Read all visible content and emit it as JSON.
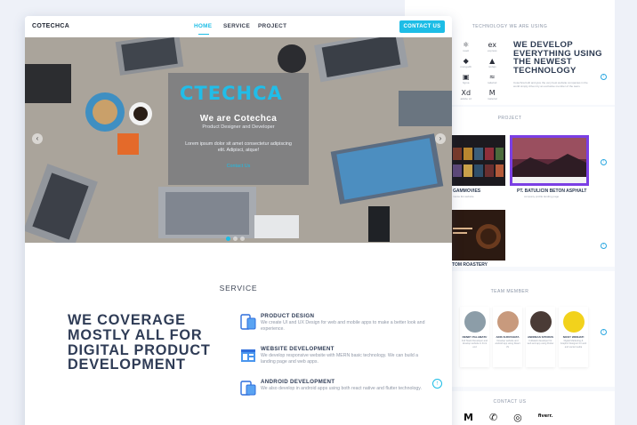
{
  "back": {
    "tech_title": "TECHNOLOGY WE ARE USING",
    "tech_icons": [
      {
        "glyph": "⚛",
        "label": "react",
        "icon": "react-icon"
      },
      {
        "glyph": "ex",
        "label": "express",
        "icon": "express-icon"
      },
      {
        "glyph": "◆",
        "label": "mongodb",
        "icon": "mongodb-icon"
      },
      {
        "glyph": "▲",
        "label": "nodejs",
        "icon": "nodejs-icon"
      },
      {
        "glyph": "▣",
        "label": "figma",
        "icon": "figma-icon"
      },
      {
        "glyph": "≈",
        "label": "tailwind",
        "icon": "tailwind-icon"
      },
      {
        "glyph": "Xd",
        "label": "adobe xd",
        "icon": "xd-icon"
      },
      {
        "glyph": "M",
        "label": "material",
        "icon": "material-icon"
      }
    ],
    "tech_heading": "WE DEVELOP EVERYTHING USING THE NEWEST TECHNOLOGY",
    "tech_text": "Cotechca built and give the very best website companies in the world simply driven by an exclusive member of the team.",
    "project_title": "PROJECT",
    "projects": [
      {
        "caption": "GAMMOVIES",
        "sub": "movie list website"
      },
      {
        "caption": "PT. BATULICIN BETON ASPHALT",
        "sub": "company profile landing page"
      },
      {
        "caption": "TOM ROASTERY",
        "sub": "coffee shop website"
      }
    ],
    "team_title": "TEAM MEMBER",
    "members": [
      {
        "name": "RENDY PALAMATU",
        "role": "Full Stack Developer and develop website in front end"
      },
      {
        "name": "ADIS SURYANATA",
        "role": "Develop website and android app using React JS"
      },
      {
        "name": "ANDREAS SITORUS",
        "role": "Fullstack developer for web and app using Flutter"
      },
      {
        "name": "NICKY WIDIHATI",
        "role": "Digital Marketing & Graphic Designer for web and social media"
      }
    ],
    "contact_title": "CONTACT US",
    "contact_icons": [
      {
        "glyph": "M",
        "icon": "gmail-icon"
      },
      {
        "glyph": "✆",
        "icon": "whatsapp-icon"
      },
      {
        "glyph": "◎",
        "icon": "instagram-icon"
      },
      {
        "glyph": "fiverr.",
        "icon": "fiverr-icon"
      }
    ]
  },
  "nav": {
    "brand": "COTECHCA",
    "links": [
      "HOME",
      "SERVICE",
      "PROJECT"
    ],
    "contact_button": "CONTACT US"
  },
  "hero": {
    "logo": "CTECHCA",
    "title": "We are Cotechca",
    "subtitle": "Product Designer and Developer",
    "text": "Lorem ipsum dolor sit amet consectetur adipiscing elit. Adipisci, atque!",
    "link": "Contact Us",
    "prev": "‹",
    "next": "›"
  },
  "service": {
    "title": "SERVICE",
    "heading": "WE COVERAGE MOSTLY ALL FOR DIGITAL PRODUCT DEVELOPMENT",
    "items": [
      {
        "title": "PRODUCT DESIGN",
        "text": "We create UI and UX Design for web and mobile apps to make a better look and experience."
      },
      {
        "title": "WEBSITE DEVELOPMENT",
        "text": "We develop responsive website with MERN basic technology. We can build a landing page and web apps."
      },
      {
        "title": "ANDROID DEVELOPMENT",
        "text": "We also develop in android apps using both react native and flutter technology."
      }
    ],
    "up": "↑"
  }
}
